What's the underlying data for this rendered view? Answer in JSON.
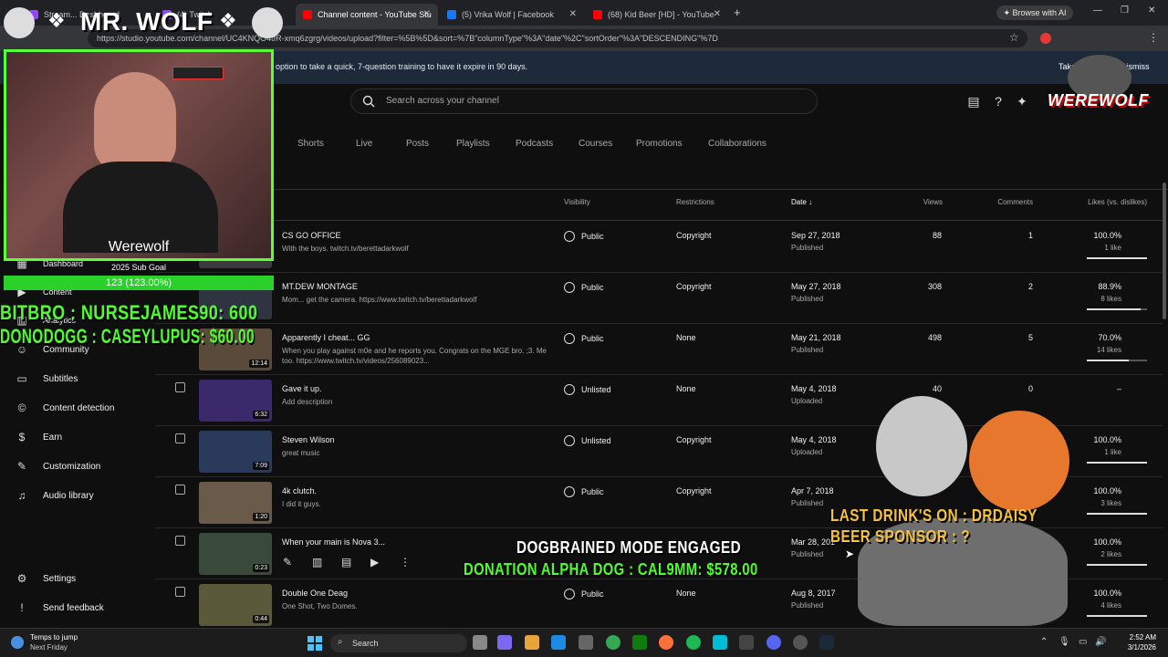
{
  "browser": {
    "tabs": [
      {
        "label": "Stream... Dashboard",
        "color": "#9147ff"
      },
      {
        "label": "(4) Twitch",
        "color": "#9147ff"
      },
      {
        "label": "Channel content - YouTube Stu",
        "color": "#ff0000"
      },
      {
        "label": "(5) Vrika Wolf | Facebook",
        "color": "#1877f2"
      },
      {
        "label": "(68) Kid Beer [HD] - YouTube",
        "color": "#ff0000"
      }
    ],
    "browse_ai": "Browse with AI",
    "url": "https://studio.youtube.com/channel/UC4KNQO4tfR-xmq6zgrg/videos/upload?filter=%5B%5D&sort=%7B\"columnType\"%3A\"date\"%2C\"sortOrder\"%3A\"DESCENDING\"%7D"
  },
  "notice": {
    "message": "option to take a quick, 7-question training to have it expire in 90 days.",
    "take_training": "Take training",
    "dismiss": "Dismiss"
  },
  "studio": {
    "search_placeholder": "Search across your channel",
    "tabs": [
      "Shorts",
      "Live",
      "Posts",
      "Playlists",
      "Podcasts",
      "Courses",
      "Promotions",
      "Collaborations"
    ],
    "columns": {
      "visibility": "Visibility",
      "restrictions": "Restrictions",
      "date": "Date",
      "views": "Views",
      "comments": "Comments",
      "likes": "Likes (vs. dislikes)"
    },
    "nav": [
      "Dashboard",
      "Content",
      "Analytics",
      "Community",
      "Subtitles",
      "Content detection",
      "Earn",
      "Customization",
      "Audio library",
      "Settings",
      "Send feedback"
    ]
  },
  "videos": [
    {
      "title": "CS GO OFFICE",
      "desc": "With the boys. twitch.tv/berettadarkwolf",
      "duration": "",
      "visibility": "Public",
      "restrictions": "Copyright",
      "date": "Sep 27, 2018",
      "status": "Published",
      "views": "88",
      "comments": "1",
      "likes": "100.0%",
      "like_count": "1 like",
      "like_ratio": 1.0
    },
    {
      "title": "MT.DEW MONTAGE",
      "desc": "Mom... get the camera. https://www.twitch.tv/berettadarkwolf",
      "duration": "",
      "visibility": "Public",
      "restrictions": "Copyright",
      "date": "May 27, 2018",
      "status": "Published",
      "views": "308",
      "comments": "2",
      "likes": "88.9%",
      "like_count": "8 likes",
      "like_ratio": 0.889
    },
    {
      "title": "Apparently I cheat... GG",
      "desc": "When you play against m0e and he reports you. Congrats on the MGE bro. ;3. Me too. https://www.twitch.tv/videos/256089023...",
      "duration": "12:14",
      "visibility": "Public",
      "restrictions": "None",
      "date": "May 21, 2018",
      "status": "Published",
      "views": "498",
      "comments": "5",
      "likes": "70.0%",
      "like_count": "14 likes",
      "like_ratio": 0.7
    },
    {
      "title": "Gave it up.",
      "desc": "Add description",
      "duration": "6:32",
      "visibility": "Unlisted",
      "restrictions": "None",
      "date": "May 4, 2018",
      "status": "Uploaded",
      "views": "40",
      "comments": "0",
      "likes": "–",
      "like_count": "",
      "like_ratio": null
    },
    {
      "title": "Steven Wilson",
      "desc": "great music",
      "duration": "7:09",
      "visibility": "Unlisted",
      "restrictions": "Copyright",
      "date": "May 4, 2018",
      "status": "Uploaded",
      "views": "",
      "comments": "",
      "likes": "100.0%",
      "like_count": "1 like",
      "like_ratio": 1.0
    },
    {
      "title": "4k clutch.",
      "desc": "I did it guys.",
      "duration": "1:20",
      "visibility": "Public",
      "restrictions": "Copyright",
      "date": "Apr 7, 2018",
      "status": "Published",
      "views": "",
      "comments": "",
      "likes": "100.0%",
      "like_count": "3 likes",
      "like_ratio": 1.0
    },
    {
      "title": "When your main is Nova 3...",
      "desc": "",
      "duration": "0:23",
      "visibility": "",
      "restrictions": "",
      "date": "Mar 28, 201",
      "status": "Published",
      "views": "",
      "comments": "",
      "likes": "100.0%",
      "like_count": "2 likes",
      "like_ratio": 1.0
    },
    {
      "title": "Double One Deag",
      "desc": "One Shot, Two Domes.",
      "duration": "0:44",
      "visibility": "Public",
      "restrictions": "None",
      "date": "Aug 8, 2017",
      "status": "Published",
      "views": "",
      "comments": "",
      "likes": "100.0%",
      "like_count": "4 likes",
      "like_ratio": 1.0
    }
  ],
  "overlay": {
    "logo": "MR. WOLF",
    "werewolf_badge": "WEREWOLF",
    "cam_name": "Werewolf",
    "goal_label": "2025 Sub Goal",
    "goal_value": "123 (123.00%)",
    "bits_line": "BITBRO : NURSEJAMES90: 600",
    "donodogg_line": "DONODOGG : CASEYLUPUS: $60.00",
    "last_drinks": "LAST DRINK'S ON : DRDAISY",
    "beer_sponsor": "BEER SPONSOR : ?",
    "dogbrained": "DOGBRAINED MODE ENGAGED",
    "donation": "DONATION ALPHA DOG : CAL9MM: $578.00"
  },
  "taskbar": {
    "weather_line1": "Temps to jump",
    "weather_line2": "Next Friday",
    "search": "Search",
    "time": "2:52 AM",
    "date": "3/1/2026"
  }
}
